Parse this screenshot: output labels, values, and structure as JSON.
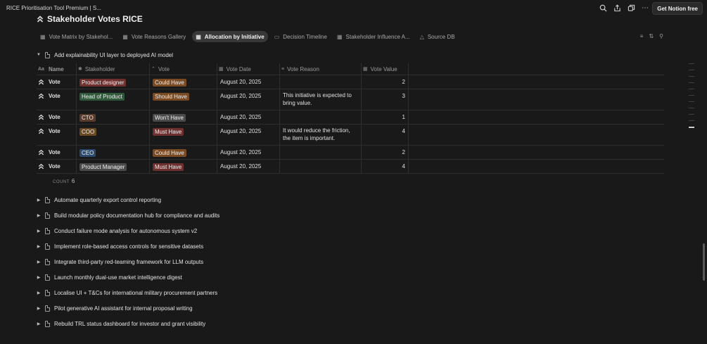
{
  "window": {
    "doc_title": "RICE Prioritisation Tool Premium | S...",
    "cta_label": "Get Notion free"
  },
  "top_icons": [
    "search-icon",
    "share-icon",
    "duplicate-icon",
    "more-icon"
  ],
  "page": {
    "title": "Stakeholder Votes RICE"
  },
  "tabs": [
    {
      "label": "Vote Matrix by Stakehol...",
      "icon": "table-icon",
      "active": false
    },
    {
      "label": "Vote Reasons Gallery",
      "icon": "gallery-icon",
      "active": false
    },
    {
      "label": "Allocation by Initiative",
      "icon": "table-icon",
      "active": true
    },
    {
      "label": "Decision Timeline",
      "icon": "timeline-icon",
      "active": false
    },
    {
      "label": "Stakeholder Influence A...",
      "icon": "table-icon",
      "active": false
    },
    {
      "label": "Source DB",
      "icon": "triangle-icon",
      "active": false
    }
  ],
  "expanded_group": {
    "title": "Add explainability UI layer to deployed AI model"
  },
  "columns": [
    "Name",
    "Stakeholder",
    "Vote",
    "Vote Date",
    "Vote Reason",
    "Vote Value"
  ],
  "rows": [
    {
      "name": "Vote",
      "stakeholder": "Product designer",
      "stakeholder_color": "#6e2f2f",
      "vote": "Could Have",
      "vote_color": "#7a4a22",
      "date": "August 20, 2025",
      "reason": "",
      "value": "2"
    },
    {
      "name": "Vote",
      "stakeholder": "Head of Product",
      "stakeholder_color": "#2f5a3c",
      "vote": "Should Have",
      "vote_color": "#7a4a22",
      "date": "August 20, 2025",
      "reason": "This initiative is expected to bring value.",
      "value": "3"
    },
    {
      "name": "Vote",
      "stakeholder": "CTO",
      "stakeholder_color": "#5a3a2a",
      "vote": "Won't Have",
      "vote_color": "#4a4a4a",
      "date": "August 20, 2025",
      "reason": "",
      "value": "1"
    },
    {
      "name": "Vote",
      "stakeholder": "COO",
      "stakeholder_color": "#6a4a22",
      "vote": "Must Have",
      "vote_color": "#6e2f2f",
      "date": "August 20, 2025",
      "reason": "It would reduce the friction, the item is important.",
      "value": "4"
    },
    {
      "name": "Vote",
      "stakeholder": "CEO",
      "stakeholder_color": "#2c4a6e",
      "vote": "Could Have",
      "vote_color": "#7a4a22",
      "date": "August 20, 2025",
      "reason": "",
      "value": "2"
    },
    {
      "name": "Vote",
      "stakeholder": "Product Manager",
      "stakeholder_color": "#4a4a4a",
      "vote": "Must Have",
      "vote_color": "#6e2f2f",
      "date": "August 20, 2025",
      "reason": "",
      "value": "4"
    }
  ],
  "count": {
    "label": "COUNT",
    "value": "6"
  },
  "collapsed_groups": [
    "Automate quarterly export control reporting",
    "Build modular policy documentation hub for compliance and audits",
    "Conduct failure mode analysis for autonomous system v2",
    "Implement role-based access controls for sensitive datasets",
    "Integrate third-party red-teaming framework for LLM outputs",
    "Launch monthly dual-use market intelligence digest",
    "Localise UI + T&Cs for international military procurement partners",
    "Pilot generative AI assistant for internal proposal writing",
    "Rebuild TRL status dashboard for investor and grant visibility"
  ]
}
